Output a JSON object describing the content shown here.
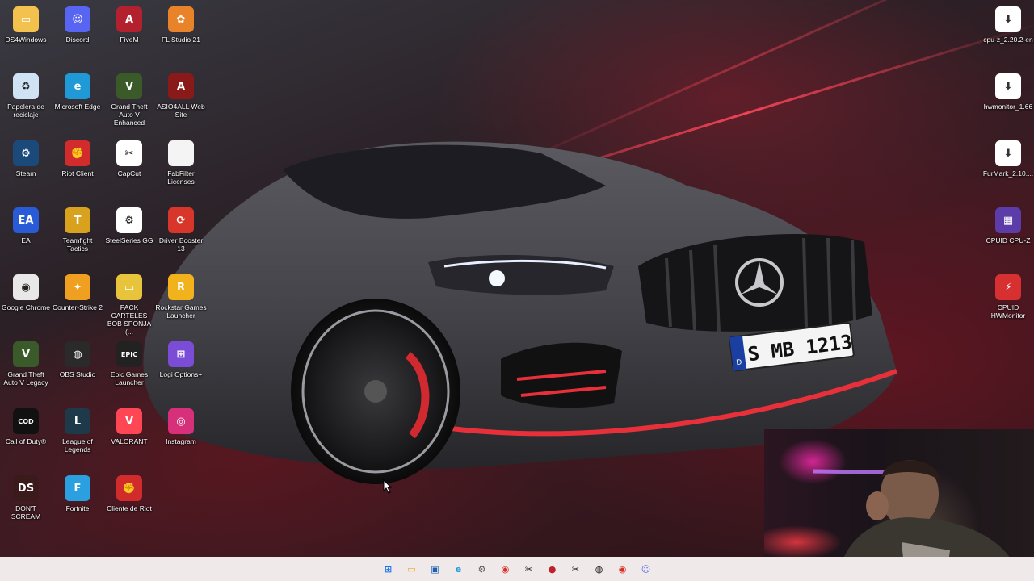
{
  "desktop": {
    "icons": [
      {
        "label": "DS4Windows",
        "icon": "folder-icon",
        "bg": "#f2c14e",
        "glyph": "▭",
        "col": 0,
        "row": 0
      },
      {
        "label": "Discord",
        "icon": "discord-icon",
        "bg": "#5865f2",
        "glyph": "☺",
        "col": 1,
        "row": 0
      },
      {
        "label": "FiveM",
        "icon": "fivem-icon",
        "bg": "#b3202e",
        "glyph": "A",
        "col": 2,
        "row": 0
      },
      {
        "label": "FL Studio 21",
        "icon": "fl-studio-icon",
        "bg": "#e8832a",
        "glyph": "✿",
        "col": 3,
        "row": 0
      },
      {
        "label": "Papelera de reciclaje",
        "icon": "recycle-bin-icon",
        "bg": "#cfe3f5",
        "glyph": "♻",
        "col": 0,
        "row": 1
      },
      {
        "label": "Microsoft Edge",
        "icon": "edge-icon",
        "bg": "#1f9ad6",
        "glyph": "e",
        "col": 1,
        "row": 1
      },
      {
        "label": "Grand Theft Auto V Enhanced",
        "icon": "gta-v-icon",
        "bg": "#3a5a2a",
        "glyph": "V",
        "col": 2,
        "row": 1
      },
      {
        "label": "ASIO4ALL Web Site",
        "icon": "asio4all-icon",
        "bg": "#8a1a1a",
        "glyph": "A",
        "col": 3,
        "row": 1
      },
      {
        "label": "Steam",
        "icon": "steam-icon",
        "bg": "#1b4a7a",
        "glyph": "⚙",
        "col": 0,
        "row": 2
      },
      {
        "label": "Riot Client",
        "icon": "riot-icon",
        "bg": "#d12b2b",
        "glyph": "✊",
        "col": 1,
        "row": 2
      },
      {
        "label": "CapCut",
        "icon": "capcut-icon",
        "bg": "#ffffff",
        "glyph": "✂",
        "col": 2,
        "row": 2
      },
      {
        "label": "FabFilter Licenses",
        "icon": "file-icon",
        "bg": "#f4f4f4",
        "glyph": "",
        "col": 3,
        "row": 2
      },
      {
        "label": "EA",
        "icon": "ea-icon",
        "bg": "#2a5bd7",
        "glyph": "EA",
        "col": 0,
        "row": 3
      },
      {
        "label": "Teamfight Tactics",
        "icon": "tft-icon",
        "bg": "#d8a21e",
        "glyph": "T",
        "col": 1,
        "row": 3
      },
      {
        "label": "SteelSeries GG",
        "icon": "steelseries-icon",
        "bg": "#ffffff",
        "glyph": "⚙",
        "col": 2,
        "row": 3
      },
      {
        "label": "Driver Booster 13",
        "icon": "driver-booster-icon",
        "bg": "#d9362b",
        "glyph": "⟳",
        "col": 3,
        "row": 3
      },
      {
        "label": "Google Chrome",
        "icon": "chrome-icon",
        "bg": "#e8e8e8",
        "glyph": "◉",
        "col": 0,
        "row": 4
      },
      {
        "label": "Counter-Strike 2",
        "icon": "cs2-icon",
        "bg": "#f0a020",
        "glyph": "✦",
        "col": 1,
        "row": 4
      },
      {
        "label": "PACK CARTELES BOB SPONJA (...",
        "icon": "folder-icon",
        "bg": "#e8c33c",
        "glyph": "▭",
        "col": 2,
        "row": 4
      },
      {
        "label": "Rockstar Games Launcher",
        "icon": "rockstar-icon",
        "bg": "#f2b21b",
        "glyph": "R",
        "col": 3,
        "row": 4
      },
      {
        "label": "Grand Theft Auto V Legacy",
        "icon": "gta-v-icon",
        "bg": "#3a5a2a",
        "glyph": "V",
        "col": 0,
        "row": 5
      },
      {
        "label": "OBS Studio",
        "icon": "obs-icon",
        "bg": "#2a2a2a",
        "glyph": "◍",
        "col": 1,
        "row": 5
      },
      {
        "label": "Epic Games Launcher",
        "icon": "epic-games-icon",
        "bg": "#222222",
        "glyph": "EPIC",
        "col": 2,
        "row": 5
      },
      {
        "label": "Logi Options+",
        "icon": "logi-icon",
        "bg": "#7b4dd6",
        "glyph": "⊞",
        "col": 3,
        "row": 5
      },
      {
        "label": "Call of Duty®",
        "icon": "call-of-duty-icon",
        "bg": "#111111",
        "glyph": "COD",
        "col": 0,
        "row": 6
      },
      {
        "label": "League of Legends",
        "icon": "league-icon",
        "bg": "#1e3a4a",
        "glyph": "L",
        "col": 1,
        "row": 6
      },
      {
        "label": "VALORANT",
        "icon": "valorant-icon",
        "bg": "#ff4655",
        "glyph": "V",
        "col": 2,
        "row": 6
      },
      {
        "label": "Instagram",
        "icon": "instagram-icon",
        "bg": "#d6307a",
        "glyph": "◎",
        "col": 3,
        "row": 6
      },
      {
        "label": "DON'T SCREAM",
        "icon": "dont-scream-icon",
        "bg": "#3a1a1a",
        "glyph": "DS",
        "col": 0,
        "row": 7
      },
      {
        "label": "Fortnite",
        "icon": "fortnite-icon",
        "bg": "#2aa0e0",
        "glyph": "F",
        "col": 1,
        "row": 7
      },
      {
        "label": "Cliente de Riot",
        "icon": "riot-icon",
        "bg": "#d12b2b",
        "glyph": "✊",
        "col": 2,
        "row": 7
      }
    ],
    "right_icons": [
      {
        "label": "cpu-z_2.20.2-en",
        "icon": "installer-icon",
        "bg": "#ffffff",
        "glyph": "⬇",
        "row": 0
      },
      {
        "label": "hwmonitor_1.66",
        "icon": "installer-icon",
        "bg": "#ffffff",
        "glyph": "⬇",
        "row": 1
      },
      {
        "label": "FurMark_2.10....",
        "icon": "installer-icon",
        "bg": "#ffffff",
        "glyph": "⬇",
        "row": 2
      },
      {
        "label": "CPUID CPU-Z",
        "icon": "cpu-z-icon",
        "bg": "#5b3ca8",
        "glyph": "▦",
        "row": 3
      },
      {
        "label": "CPUID HWMonitor",
        "icon": "hwmonitor-icon",
        "bg": "#d63030",
        "glyph": "⚡",
        "row": 4
      }
    ]
  },
  "wallpaper": {
    "plate_text": "S MB 1213",
    "plate_country": "D"
  },
  "taskbar": {
    "items": [
      {
        "name": "start-icon",
        "glyph": "⊞",
        "color": "#1a73e8",
        "bg": "transparent"
      },
      {
        "name": "file-explorer-icon",
        "glyph": "▭",
        "color": "#e8a820",
        "bg": "transparent"
      },
      {
        "name": "store-icon",
        "glyph": "▣",
        "color": "#1a5fb4",
        "bg": "transparent"
      },
      {
        "name": "edge-icon",
        "glyph": "e",
        "color": "#1f9ad6",
        "bg": "transparent"
      },
      {
        "name": "settings-icon",
        "glyph": "⚙",
        "color": "#555555",
        "bg": "transparent"
      },
      {
        "name": "chrome-icon",
        "glyph": "◉",
        "color": "#d93025",
        "bg": "transparent"
      },
      {
        "name": "capcut-icon",
        "glyph": "✂",
        "color": "#111111",
        "bg": "transparent"
      },
      {
        "name": "record-icon",
        "glyph": "●",
        "color": "#c0202a",
        "bg": "transparent"
      },
      {
        "name": "capcut-icon",
        "glyph": "✂",
        "color": "#111111",
        "bg": "transparent"
      },
      {
        "name": "obs-icon",
        "glyph": "◍",
        "color": "#222222",
        "bg": "transparent"
      },
      {
        "name": "chrome-icon",
        "glyph": "◉",
        "color": "#d93025",
        "bg": "transparent"
      },
      {
        "name": "discord-icon",
        "glyph": "☺",
        "color": "#5865f2",
        "bg": "transparent"
      }
    ]
  }
}
